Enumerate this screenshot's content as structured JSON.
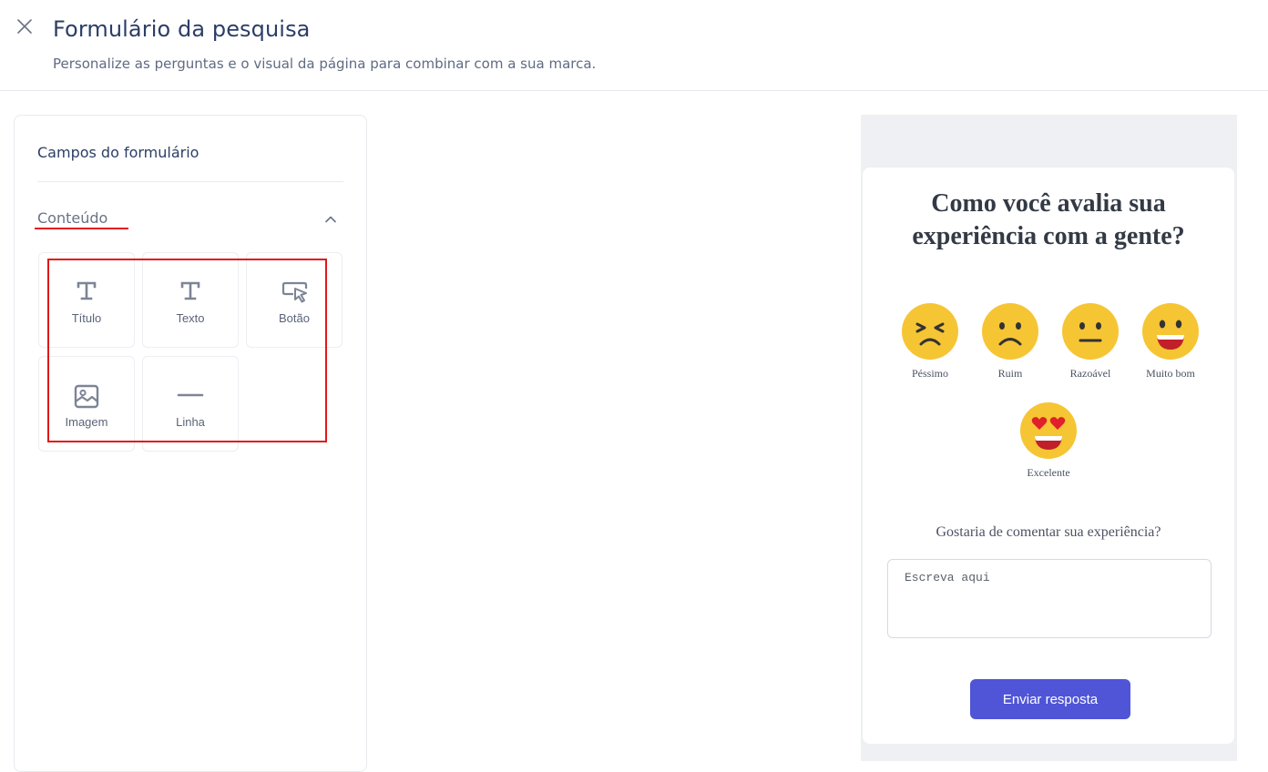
{
  "header": {
    "title": "Formulário da pesquisa",
    "subtitle": "Personalize as perguntas e o visual da página para combinar com a sua marca."
  },
  "left_panel": {
    "title": "Campos do formulário",
    "section_label": "Conteúdo",
    "tiles": [
      {
        "label": "Título",
        "icon": "title-icon"
      },
      {
        "label": "Texto",
        "icon": "text-icon"
      },
      {
        "label": "Botão",
        "icon": "button-cursor-icon"
      },
      {
        "label": "Imagem",
        "icon": "image-icon"
      },
      {
        "label": "Linha",
        "icon": "line-icon"
      }
    ]
  },
  "preview": {
    "question": "Como você avalia sua experiência com a gente?",
    "ratings": [
      {
        "label": "Péssimo",
        "icon": "squint-face-icon"
      },
      {
        "label": "Ruim",
        "icon": "frown-face-icon"
      },
      {
        "label": "Razoável",
        "icon": "neutral-face-icon"
      },
      {
        "label": "Muito bom",
        "icon": "grin-face-icon"
      },
      {
        "label": "Excelente",
        "icon": "heart-eyes-face-icon"
      }
    ],
    "comment_label": "Gostaria de comentar sua experiência?",
    "comment_placeholder": "Escreva aqui",
    "submit_label": "Enviar resposta"
  },
  "colors": {
    "accent": "#4f55d6",
    "highlight": "#e01818",
    "emoji": "#f6c534"
  }
}
